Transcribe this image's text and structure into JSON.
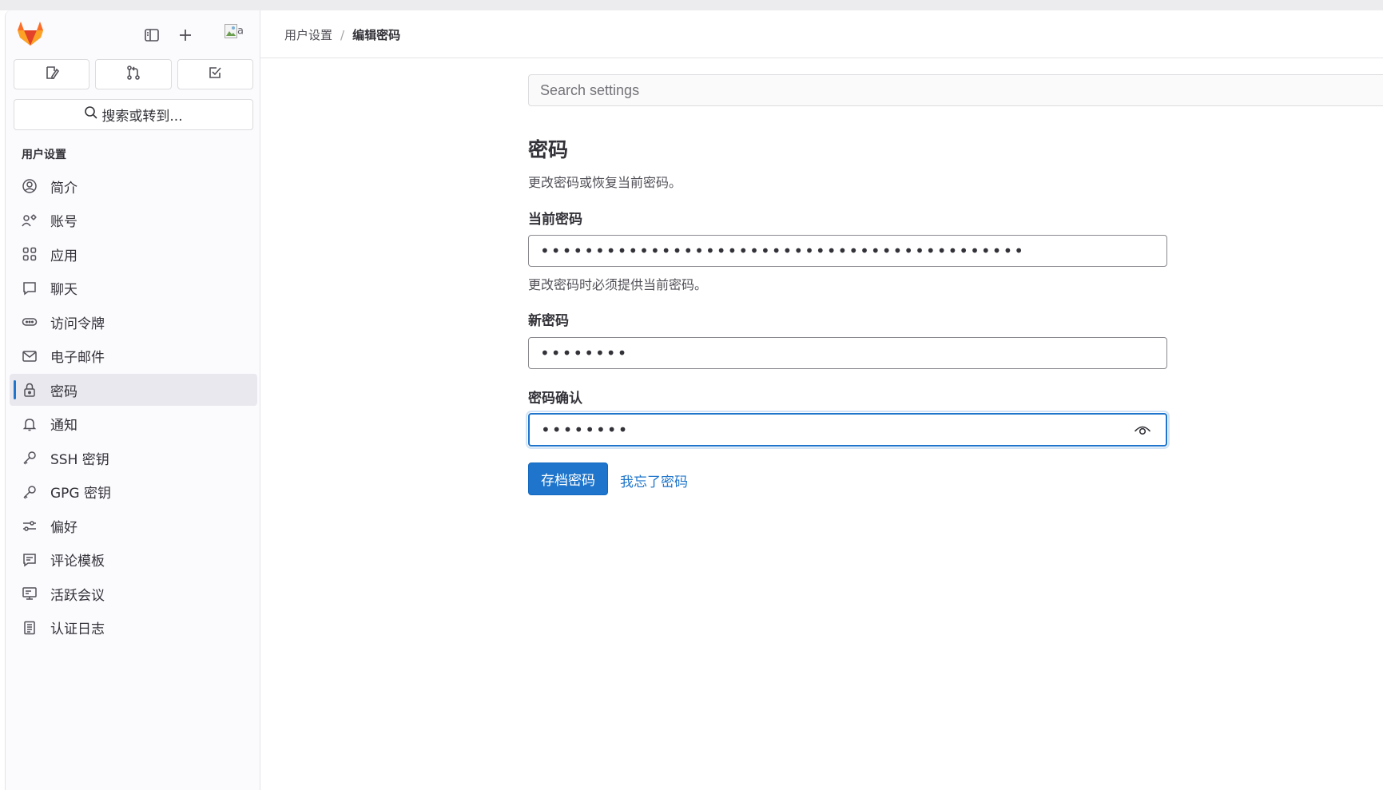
{
  "sidebar": {
    "logo_icon": "gitlab-tanuki-icon",
    "toggle_icon": "sidebar-toggle-icon",
    "new_icon": "plus-icon",
    "avatar_alt": "a",
    "quick_actions": [
      {
        "name": "issues-button",
        "icon": "issues-icon"
      },
      {
        "name": "merge-requests-button",
        "icon": "merge-request-icon"
      },
      {
        "name": "todos-button",
        "icon": "todo-icon"
      }
    ],
    "search_label": "搜索或转到...",
    "section_title": "用户设置",
    "items": [
      {
        "id": "profile",
        "label": "简介",
        "icon": "user-circle-icon"
      },
      {
        "id": "account",
        "label": "账号",
        "icon": "account-gear-icon"
      },
      {
        "id": "applications",
        "label": "应用",
        "icon": "grid-icon"
      },
      {
        "id": "chat",
        "label": "聊天",
        "icon": "comment-icon"
      },
      {
        "id": "access-tokens",
        "label": "访问令牌",
        "icon": "token-icon"
      },
      {
        "id": "emails",
        "label": "电子邮件",
        "icon": "mail-icon"
      },
      {
        "id": "password",
        "label": "密码",
        "icon": "lock-icon",
        "active": true
      },
      {
        "id": "notifications",
        "label": "通知",
        "icon": "bell-icon"
      },
      {
        "id": "ssh-keys",
        "label": "SSH 密钥",
        "icon": "key-icon"
      },
      {
        "id": "gpg-keys",
        "label": "GPG 密钥",
        "icon": "key-icon"
      },
      {
        "id": "preferences",
        "label": "偏好",
        "icon": "preferences-icon"
      },
      {
        "id": "comment-templates",
        "label": "评论模板",
        "icon": "comment-template-icon"
      },
      {
        "id": "active-sessions",
        "label": "活跃会议",
        "icon": "monitor-icon"
      },
      {
        "id": "auth-log",
        "label": "认证日志",
        "icon": "log-icon"
      }
    ]
  },
  "header": {
    "breadcrumbs": [
      "用户设置",
      "编辑密码"
    ]
  },
  "main": {
    "search_placeholder": "Search settings",
    "title": "密码",
    "description": "更改密码或恢复当前密码。",
    "current_password": {
      "label": "当前密码",
      "value": "••••••••••••••••••••••••••••••••••••••••••••",
      "help": "更改密码时必须提供当前密码。"
    },
    "new_password": {
      "label": "新密码",
      "value": "••••••••"
    },
    "confirm_password": {
      "label": "密码确认",
      "value": "••••••••",
      "toggle_icon": "eye-icon"
    },
    "save_button": "存档密码",
    "forgot_link": "我忘了密码"
  },
  "colors": {
    "accent": "#1f75cb",
    "sidebar_bg": "#fbfafd",
    "active_item_bg": "#e9e8ee",
    "logo_orange": "#fc6d26"
  }
}
